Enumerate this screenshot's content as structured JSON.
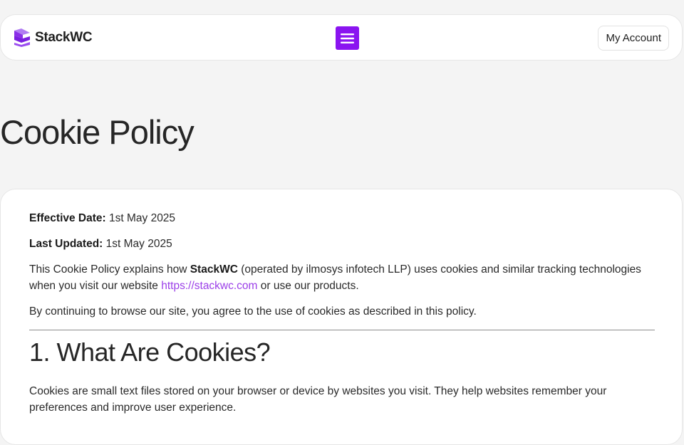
{
  "header": {
    "logo_text": "StackWC",
    "account_label": "My Account",
    "accent_color": "#8a14f0"
  },
  "page": {
    "title": "Cookie Policy"
  },
  "content": {
    "effective_label": "Effective Date:",
    "effective_value": "1st May 2025",
    "updated_label": "Last Updated:",
    "updated_value": "1st May 2025",
    "intro_part1": "This Cookie Policy explains how ",
    "intro_brand": "StackWC",
    "intro_part2": " (operated by ilmosys infotech LLP) uses cookies and similar tracking technologies when you visit our website ",
    "intro_link": "https://stackwc.com",
    "intro_part3": " or use our products.",
    "agree_text": "By continuing to browse our site, you agree to the use of cookies as described in this policy.",
    "section1_title": "1. What Are Cookies?",
    "section1_text": "Cookies are small text files stored on your browser or device by websites you visit. They help websites remember your preferences and improve user experience."
  }
}
